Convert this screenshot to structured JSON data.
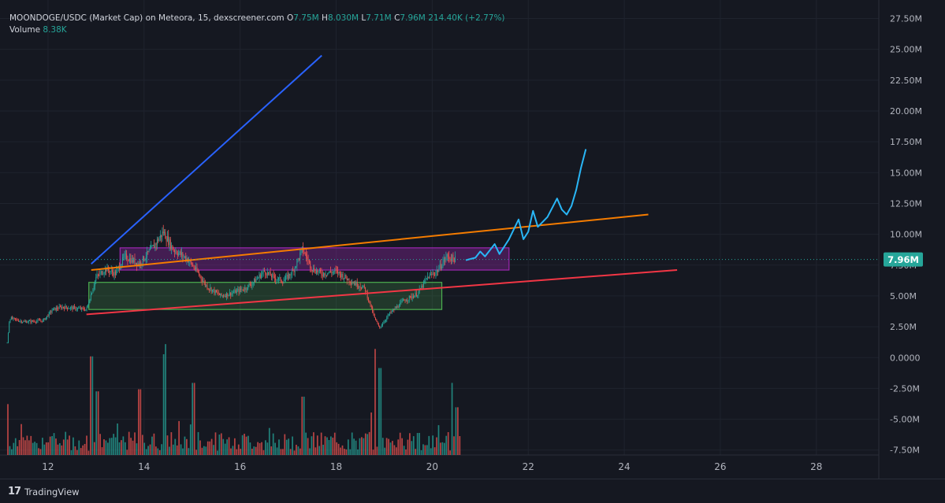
{
  "header": {
    "symbol": "MOONDOGE/USDC (Market Cap) on Meteora, 15, dexscreener.com",
    "o_label": "O",
    "o_value": "7.75M",
    "h_label": "H",
    "h_value": "8.030M",
    "l_label": "L",
    "l_value": "7.71M",
    "c_label": "C",
    "c_value": "7.96M",
    "change": "214.40K (+2.77%)",
    "volume_label": "Volume",
    "volume_value": "8.38K"
  },
  "price_tag": "7.96M",
  "brand": "TradingView",
  "colors": {
    "background": "#151821",
    "up": "#26a69a",
    "down": "#ef5350",
    "blue_line": "#2962ff",
    "orange_line": "#f57c00",
    "red_line": "#f23645",
    "purple_box": "#9c27b0",
    "green_box": "#4caf50",
    "projection": "#29b6f6"
  },
  "chart_data": {
    "type": "candlestick",
    "x_ticks": [
      "12",
      "14",
      "16",
      "18",
      "20",
      "22",
      "24",
      "26",
      "28"
    ],
    "x_tick_values": [
      12,
      14,
      16,
      18,
      20,
      22,
      24,
      26,
      28
    ],
    "xlim": [
      11,
      29.3
    ],
    "y_ticks": [
      "27.50M",
      "25.00M",
      "22.50M",
      "20.00M",
      "17.50M",
      "15.00M",
      "12.50M",
      "10.00M",
      "7.50M",
      "5.00M",
      "2.50M",
      "0.0000",
      "-2.50M",
      "-5.00M",
      "-7.50M"
    ],
    "y_tick_values": [
      27.5,
      25,
      22.5,
      20,
      17.5,
      15,
      12.5,
      10,
      7.5,
      5,
      2.5,
      0,
      -2.5,
      -5,
      -7.5
    ],
    "ylim": [
      -7.9,
      29
    ],
    "last_price": 7.96,
    "price_path": [
      [
        11.15,
        1.2
      ],
      [
        11.2,
        3.2
      ],
      [
        11.5,
        2.9
      ],
      [
        11.9,
        3.0
      ],
      [
        12.1,
        3.9
      ],
      [
        12.3,
        4.1
      ],
      [
        12.8,
        3.9
      ],
      [
        13.0,
        6.5
      ],
      [
        13.2,
        7.2
      ],
      [
        13.4,
        6.8
      ],
      [
        13.6,
        8.2
      ],
      [
        13.9,
        7.6
      ],
      [
        14.2,
        9.0
      ],
      [
        14.4,
        10.2
      ],
      [
        14.6,
        8.8
      ],
      [
        14.9,
        8.0
      ],
      [
        15.1,
        7.0
      ],
      [
        15.3,
        5.8
      ],
      [
        15.6,
        5.0
      ],
      [
        15.8,
        5.2
      ],
      [
        16.1,
        5.6
      ],
      [
        16.3,
        6.2
      ],
      [
        16.5,
        7.0
      ],
      [
        16.7,
        6.5
      ],
      [
        16.9,
        6.2
      ],
      [
        17.1,
        7.0
      ],
      [
        17.3,
        8.8
      ],
      [
        17.5,
        7.2
      ],
      [
        17.7,
        6.8
      ],
      [
        18.0,
        7.0
      ],
      [
        18.3,
        6.2
      ],
      [
        18.6,
        5.6
      ],
      [
        18.8,
        3.2
      ],
      [
        18.9,
        2.4
      ],
      [
        19.1,
        3.5
      ],
      [
        19.4,
        4.6
      ],
      [
        19.7,
        5.2
      ],
      [
        19.9,
        6.5
      ],
      [
        20.1,
        7.0
      ],
      [
        20.3,
        8.2
      ],
      [
        20.5,
        7.96
      ]
    ],
    "volume_bars": {
      "x_start": 11.15,
      "x_end": 20.6,
      "count": 236,
      "baseline": -7.9
    },
    "volume_spikes": [
      [
        11.15,
        0.48
      ],
      [
        12.9,
        0.93
      ],
      [
        13.0,
        0.6
      ],
      [
        13.9,
        0.62
      ],
      [
        14.4,
        0.95
      ],
      [
        15.0,
        0.68
      ],
      [
        17.3,
        0.55
      ],
      [
        18.8,
        1.0
      ],
      [
        18.9,
        0.82
      ],
      [
        20.4,
        0.68
      ],
      [
        20.5,
        0.45
      ]
    ],
    "trend_lines": [
      {
        "x1": 12.9,
        "y1": 7.6,
        "x2": 17.7,
        "y2": 24.5
      },
      {
        "x1": 12.9,
        "y1": 7.1,
        "x2": 24.5,
        "y2": 11.6
      },
      {
        "x1": 12.8,
        "y1": 3.5,
        "x2": 25.1,
        "y2": 7.1
      }
    ],
    "zones": [
      {
        "x1": 13.5,
        "x2": 21.6,
        "y1": 7.1,
        "y2": 8.9
      },
      {
        "x1": 12.85,
        "x2": 20.2,
        "y1": 3.9,
        "y2": 6.1
      }
    ],
    "projection_path": [
      [
        20.7,
        7.9
      ],
      [
        20.9,
        8.1
      ],
      [
        21.0,
        8.6
      ],
      [
        21.1,
        8.2
      ],
      [
        21.3,
        9.2
      ],
      [
        21.4,
        8.4
      ],
      [
        21.6,
        9.6
      ],
      [
        21.8,
        11.2
      ],
      [
        21.9,
        9.6
      ],
      [
        22.0,
        10.2
      ],
      [
        22.1,
        11.9
      ],
      [
        22.2,
        10.6
      ],
      [
        22.4,
        11.4
      ],
      [
        22.6,
        12.9
      ],
      [
        22.7,
        12.0
      ],
      [
        22.8,
        11.6
      ],
      [
        22.9,
        12.3
      ],
      [
        23.0,
        13.6
      ],
      [
        23.1,
        15.4
      ],
      [
        23.2,
        16.9
      ]
    ]
  }
}
